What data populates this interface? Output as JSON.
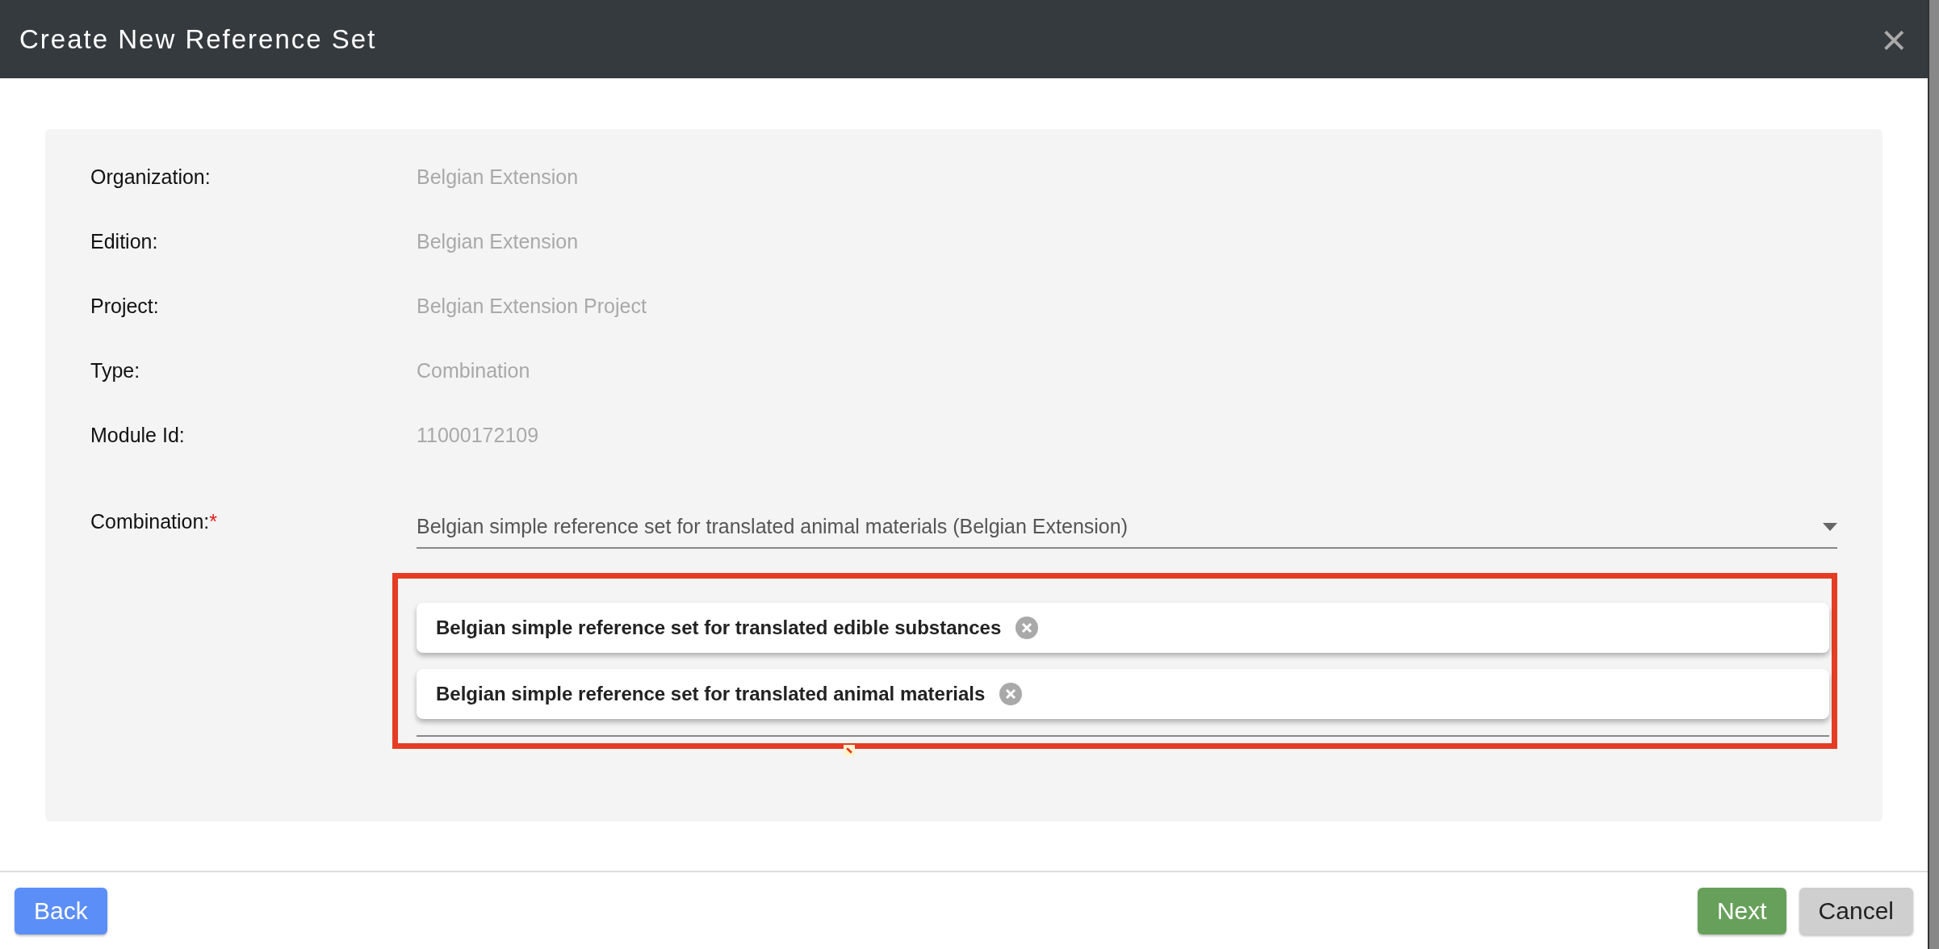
{
  "dialog": {
    "title": "Create New Reference Set",
    "close_glyph": "×"
  },
  "fields": [
    {
      "label": "Organization:",
      "value": "Belgian Extension"
    },
    {
      "label": "Edition:",
      "value": "Belgian Extension"
    },
    {
      "label": "Project:",
      "value": "Belgian Extension Project"
    },
    {
      "label": "Type:",
      "value": "Combination"
    },
    {
      "label": "Module Id:",
      "value": "11000172109"
    }
  ],
  "combination": {
    "label": "Combination:",
    "required_mark": "*",
    "value": "Belgian simple reference set for translated animal materials (Belgian Extension)",
    "highlighted": true,
    "chips": [
      {
        "label": "Belgian simple reference set for translated edible substances"
      },
      {
        "label": "Belgian simple reference set for translated animal materials"
      }
    ]
  },
  "buttons": [
    {
      "label": "Back",
      "kind": "primary"
    },
    {
      "label": "Next",
      "kind": "success"
    },
    {
      "label": "Cancel",
      "kind": "secondary"
    }
  ]
}
